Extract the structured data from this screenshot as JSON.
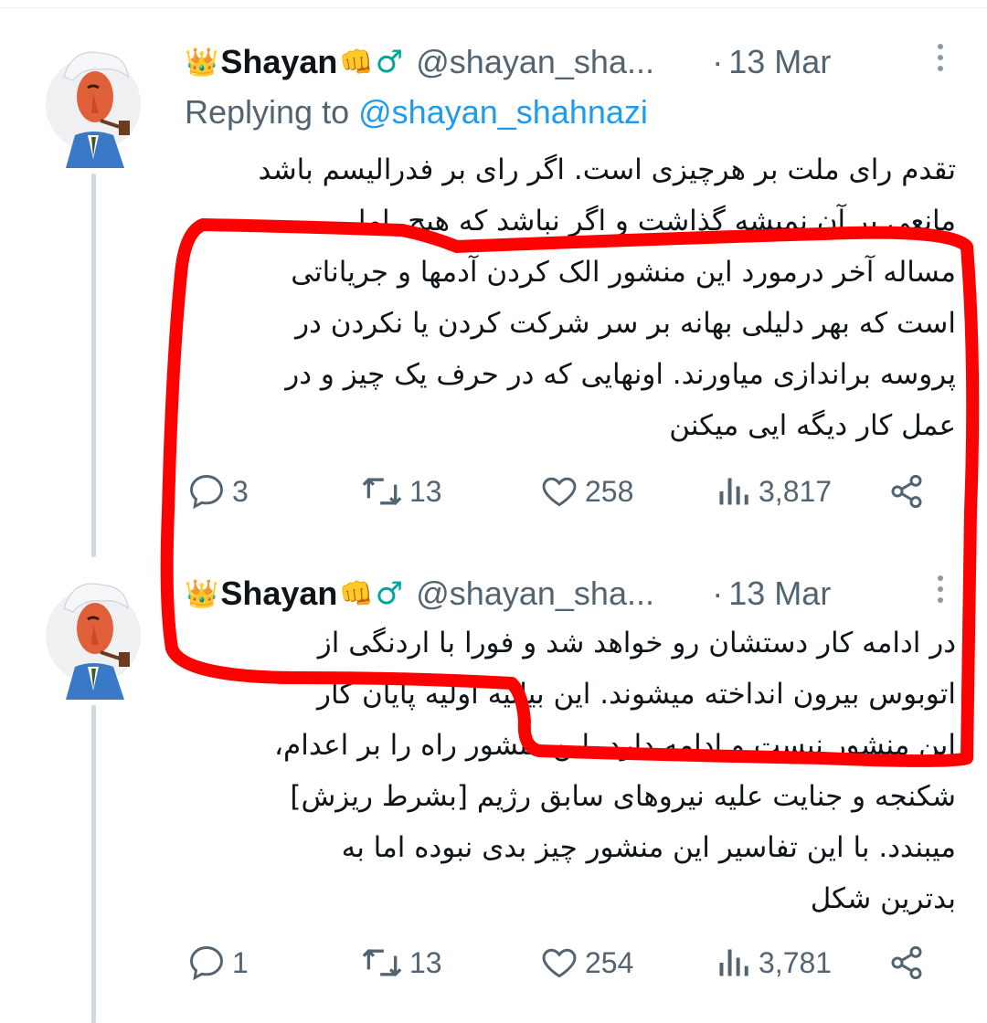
{
  "tweets": [
    {
      "author": {
        "crown": "👑",
        "name": "Shayan",
        "fist": "👊",
        "male": "♂",
        "handle": "@shayan_sha...",
        "date": "13 Mar"
      },
      "replying_label": "Replying to",
      "replying_handle": "@shayan_shahnazi",
      "text_lines": [
        "تقدم رای ملت بر هرچیزی است. اگر رای بر فدرالیسم باشد",
        "مانعی بر آن نمیشه گذاشت و اگر نباشد که هیچ. اما",
        "مساله آخر درمورد این منشور الک کردن آدمها و جریاناتی",
        "است که بهر دلیلی بهانه بر سر شرکت کردن یا نکردن در",
        "پروسه براندازی میاورند. اونهایی که در حرف یک چیز و در",
        "عمل کار دیگه ایی میکنن"
      ],
      "stats": {
        "replies": "3",
        "reposts": "13",
        "likes": "258",
        "views": "3,817"
      }
    },
    {
      "author": {
        "crown": "👑",
        "name": "Shayan",
        "fist": "👊",
        "male": "♂",
        "handle": "@shayan_sha...",
        "date": "13 Mar"
      },
      "text_lines": [
        "در ادامه کار دستشان رو خواهد شد و فورا با اردنگی از",
        "اتوبوس بیرون انداخته میشوند. این بیانیه اولیه پایان کار",
        "این منشور نیست و ادامه دارد. این منشور راه را بر اعدام،",
        "شکنجه و جنایت علیه نیروهای سابق رژیم [بشرط ریزش]",
        "میبندد. با این تفاسیر این منشور چیز بدی نبوده اما به",
        "بدترین شکل"
      ],
      "stats": {
        "replies": "1",
        "reposts": "13",
        "likes": "254",
        "views": "3,781"
      }
    }
  ],
  "colors": {
    "annotation": "#ff0000",
    "link": "#1d9bf0",
    "secondary_text": "#536471",
    "thread_line": "#cfd9de"
  },
  "icons": [
    "more-icon",
    "reply-icon",
    "repost-icon",
    "like-icon",
    "views-icon",
    "share-icon"
  ]
}
